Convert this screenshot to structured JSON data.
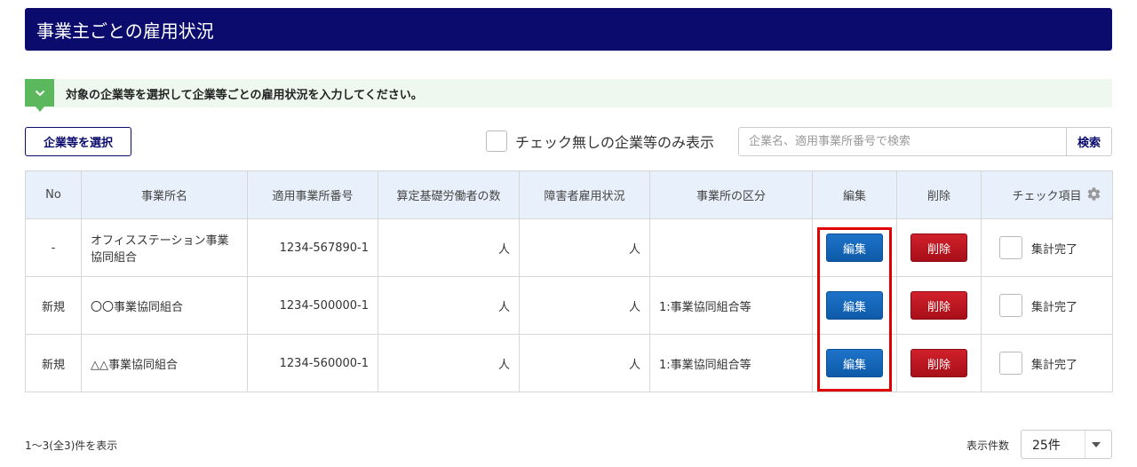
{
  "header": {
    "title": "事業主ごとの雇用状況"
  },
  "notice": {
    "text": "対象の企業等を選択して企業等ごとの雇用状況を入力してください。",
    "icon": "chevron-down-icon",
    "color": "#5cb85c"
  },
  "toolbar": {
    "select_button": "企業等を選択",
    "filter_label": "チェック無しの企業等のみ表示",
    "search_placeholder": "企業名、適用事業所番号で検索",
    "search_button": "検索"
  },
  "table": {
    "headers": [
      "No",
      "事業所名",
      "適用事業所番号",
      "算定基礎労働者の数",
      "障害者雇用状況",
      "事業所の区分",
      "編集",
      "削除",
      "チェック項目"
    ],
    "rows": [
      {
        "no": "-",
        "name": "オフィスステーション事業協同組合",
        "number": "1234-567890-1",
        "workers": "人",
        "disabled": "人",
        "category": "",
        "edit": "編集",
        "delete": "削除",
        "check_label": "集計完了"
      },
      {
        "no": "新規",
        "name": "〇〇事業協同組合",
        "number": "1234-500000-1",
        "workers": "人",
        "disabled": "人",
        "category": "1:事業協同組合等",
        "edit": "編集",
        "delete": "削除",
        "check_label": "集計完了"
      },
      {
        "no": "新規",
        "name": "△△事業協同組合",
        "number": "1234-560000-1",
        "workers": "人",
        "disabled": "人",
        "category": "1:事業協同組合等",
        "edit": "編集",
        "delete": "削除",
        "check_label": "集計完了"
      }
    ]
  },
  "footer": {
    "summary": "1〜3(全3)件を表示",
    "per_page_label": "表示件数",
    "per_page_value": "25件"
  },
  "colors": {
    "header_bg": "#0b0b6e",
    "edit": "#1565b8",
    "delete": "#b8141e",
    "highlight": "#e00000"
  }
}
